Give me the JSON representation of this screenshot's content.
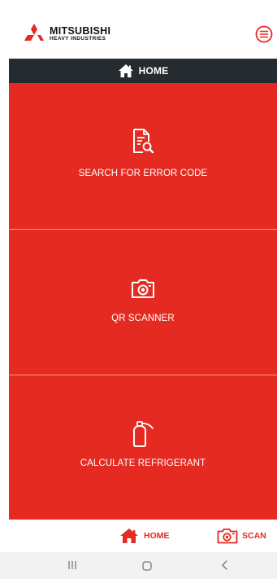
{
  "header": {
    "brand_name": "MITSUBISHI",
    "brand_sub": "HEAVY INDUSTRIES",
    "menu_icon": "menu-circle-icon"
  },
  "titlebar": {
    "title": "HOME",
    "icon": "home-icon"
  },
  "tiles": [
    {
      "label": "SEARCH FOR ERROR CODE",
      "icon": "document-search-icon"
    },
    {
      "label": "QR SCANNER",
      "icon": "camera-icon"
    },
    {
      "label": "CALCULATE REFRIGERANT",
      "icon": "gas-cylinder-icon"
    }
  ],
  "bottom_nav": {
    "home_label": "HOME",
    "scan_label": "SCAN"
  },
  "colors": {
    "accent_red": "#e42a21",
    "titlebar_dark": "#262b30"
  }
}
